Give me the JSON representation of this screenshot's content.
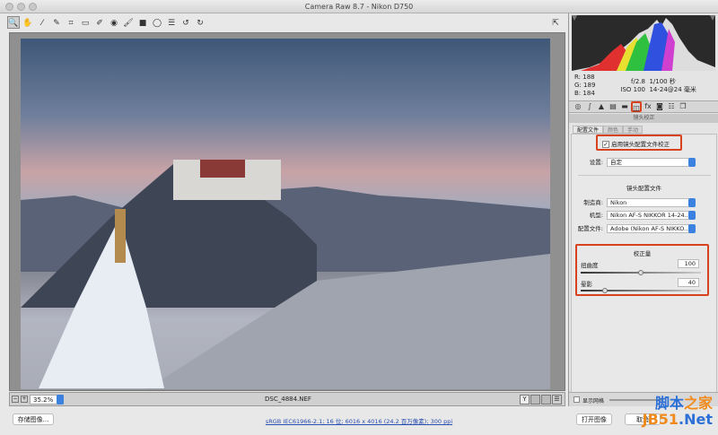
{
  "window": {
    "title": "Camera Raw 8.7 -  Nikon D750"
  },
  "toolbar": {
    "tools": [
      "zoom-icon",
      "hand-icon",
      "white-balance-icon",
      "color-sampler-icon",
      "crop-icon",
      "straighten-icon",
      "spot-removal-icon",
      "red-eye-icon",
      "brush-icon",
      "graduated-filter-icon",
      "radial-filter-icon",
      "preferences-icon",
      "rotate-left-icon",
      "rotate-right-icon"
    ]
  },
  "image": {
    "filename": "DSC_4884.NEF",
    "zoom": "35.2%"
  },
  "info": {
    "r_label": "R:",
    "r": "188",
    "g_label": "G:",
    "g": "189",
    "b_label": "B:",
    "b": "184",
    "aperture": "f/2.8",
    "shutter": "1/100 秒",
    "iso": "ISO 100",
    "lens": "14-24@24 毫米"
  },
  "panel": {
    "title": "镜头校正",
    "tabs": [
      "配置文件",
      "颜色",
      "手动"
    ],
    "enable_label": "启用镜头配置文件校正",
    "enable_checked": true,
    "setup_label": "设置:",
    "setup_value": "自定",
    "profile_title": "镜头配置文件",
    "make_label": "制造商:",
    "make_value": "Nikon",
    "model_label": "机型:",
    "model_value": "Nikon AF-S NIKKOR 14-24...",
    "profile_label": "配置文件:",
    "profile_value": "Adobe (Nikon AF-S NIKKO...",
    "amount_title": "校正量",
    "distortion_label": "扭曲度",
    "distortion_value": "100",
    "vignette_label": "晕影",
    "vignette_value": "40"
  },
  "grid": {
    "label": "显示网格",
    "checked": false
  },
  "footer": {
    "save": "存储图像...",
    "workflow": "sRGB IEC61966-2.1; 16 位; 6016 x 4016 (24.2 百万像素); 300 ppi",
    "open": "打开图像",
    "cancel": "取消"
  },
  "watermark": {
    "line1": "脚本之家",
    "line2": "JB51.Net"
  },
  "colors": {
    "highlight": "#d9421f",
    "accent": "#3b82e0"
  }
}
